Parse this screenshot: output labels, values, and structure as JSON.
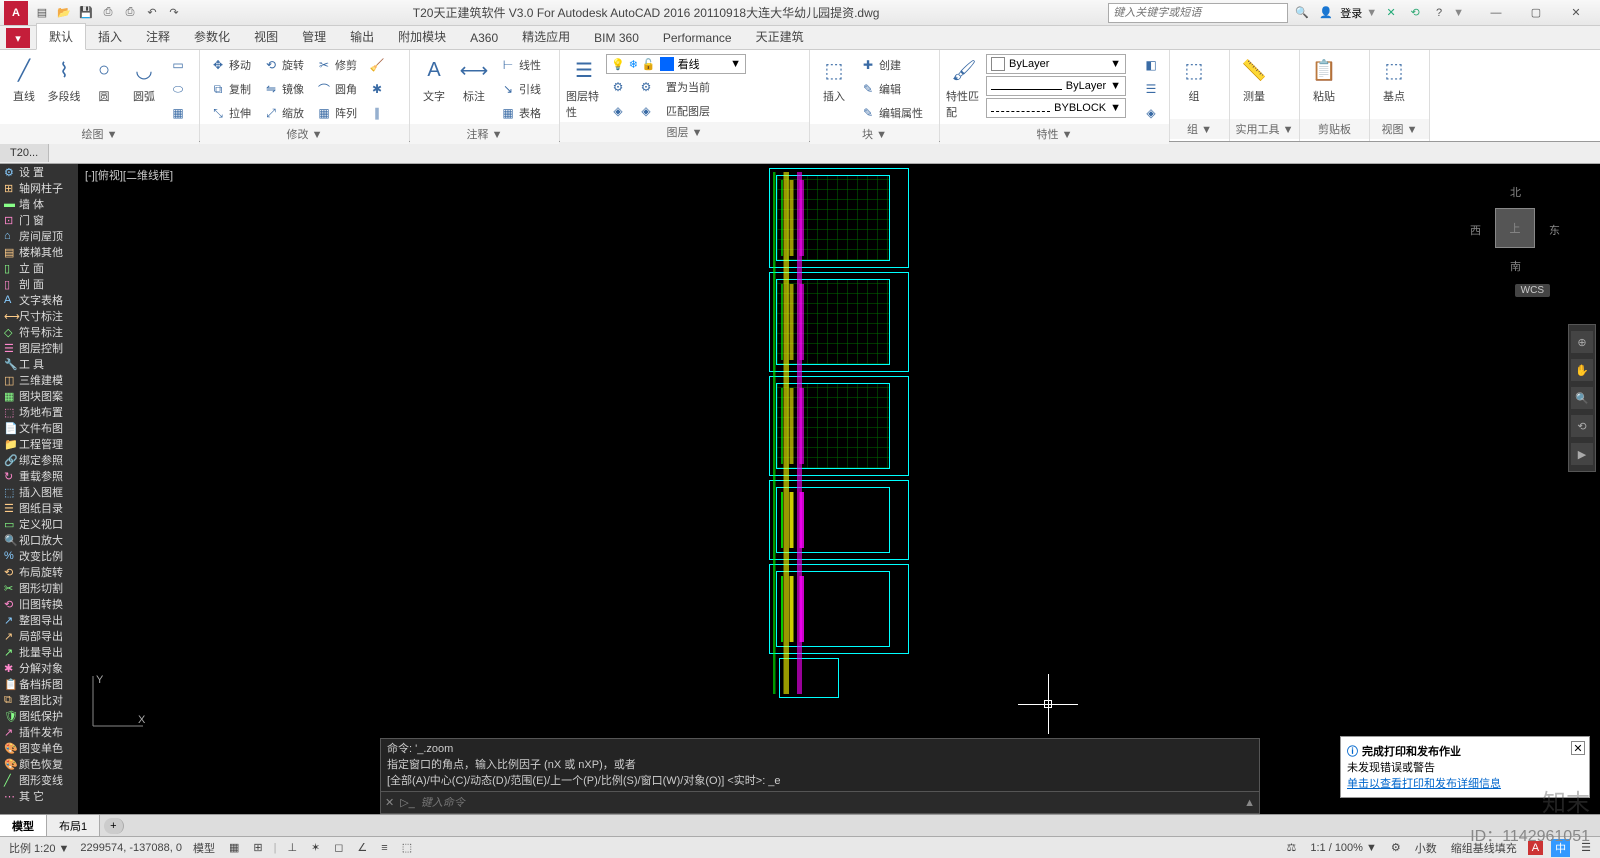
{
  "title": "T20天正建筑软件 V3.0 For Autodesk AutoCAD 2016   20110918大连大华幼儿园提资.dwg",
  "search_placeholder": "键入关键字或短语",
  "login": "登录",
  "ribbon_tabs": [
    "默认",
    "插入",
    "注释",
    "参数化",
    "视图",
    "管理",
    "输出",
    "附加模块",
    "A360",
    "精选应用",
    "BIM 360",
    "Performance",
    "天正建筑"
  ],
  "panels": {
    "draw": {
      "title": "绘图 ▼",
      "btns": [
        "直线",
        "多段线",
        "圆",
        "圆弧"
      ]
    },
    "modify": {
      "title": "修改 ▼",
      "rows": [
        [
          "移动",
          "旋转",
          "修剪"
        ],
        [
          "复制",
          "镜像",
          "圆角"
        ],
        [
          "拉伸",
          "缩放",
          "阵列"
        ]
      ]
    },
    "annot": {
      "title": "注释 ▼",
      "btns": [
        "文字",
        "标注"
      ],
      "side": [
        "线性",
        "引线",
        "表格"
      ]
    },
    "layer": {
      "title": "图层 ▼",
      "btn": "图层特性",
      "ops": [
        "置为当前",
        "匹配图层"
      ],
      "dd": "看线"
    },
    "block": {
      "title": "块 ▼",
      "btn": "插入",
      "side": [
        "创建",
        "编辑",
        "编辑属性"
      ]
    },
    "prop": {
      "title": "特性 ▼",
      "btn": "特性匹配",
      "bylayer": "ByLayer",
      "byblock": "BYBLOCK"
    },
    "group": {
      "title": "组 ▼",
      "btn": "组"
    },
    "util": {
      "title": "实用工具 ▼",
      "btn": "测量"
    },
    "clip": {
      "title": "剪贴板",
      "btn": "粘贴"
    },
    "view": {
      "title": "视图 ▼",
      "btn": "基点"
    }
  },
  "filetab": "T20...",
  "viewport_label": "[-][俯视][二维线框]",
  "t20_items": [
    "设    置",
    "轴网柱子",
    "墙    体",
    "门    窗",
    "房间屋顶",
    "楼梯其他",
    "立    面",
    "剖    面",
    "文字表格",
    "尺寸标注",
    "符号标注",
    "图层控制",
    "工    具",
    "三维建模",
    "图块图案",
    "场地布置",
    "文件布图",
    "工程管理",
    "绑定参照",
    "重载参照",
    "插入图框",
    "图纸目录",
    "定义视口",
    "视口放大",
    "改变比例",
    "布局旋转",
    "图形切割",
    "旧图转换",
    "整图导出",
    "局部导出",
    "批量导出",
    "分解对象",
    "备档拆图",
    "整图比对",
    "图纸保护",
    "插件发布",
    "图变单色",
    "颜色恢复",
    "图形变线",
    "其    它"
  ],
  "compass": {
    "n": "北",
    "s": "南",
    "e": "东",
    "w": "西",
    "top": "上"
  },
  "wcs": "WCS",
  "cmd_history": [
    "命令: '_.zoom",
    "指定窗口的角点，输入比例因子 (nX 或 nXP)，或者",
    "[全部(A)/中心(C)/动态(D)/范围(E)/上一个(P)/比例(S)/窗口(W)/对象(O)] <实时>: _e"
  ],
  "cmd_placeholder": "键入命令",
  "balloon": {
    "title": "完成打印和发布作业",
    "msg": "未发现错误或警告",
    "link": "单击以查看打印和发布详细信息"
  },
  "model_tabs": [
    "模型",
    "布局1"
  ],
  "status": {
    "scale": "比例 1:20 ▼",
    "coords": "2299574, -137088, 0",
    "mode": "模型",
    "annoscale": "1:1 / 100% ▼",
    "decimal": "小数",
    "opts": "缩组基线填充"
  },
  "idtext": "ID：1142961051",
  "brand": "知末"
}
